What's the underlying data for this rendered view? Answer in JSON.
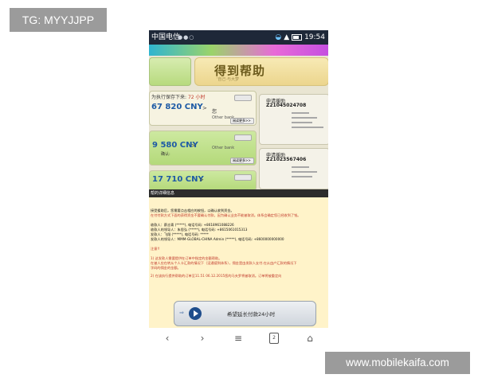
{
  "watermark": {
    "tag": "TG: MYYJJPP",
    "site": "www.mobilekaifa.com"
  },
  "statusbar": {
    "carrier": "中国电信",
    "time": "19:54",
    "icons": [
      "wechat-icon",
      "wechat-icon",
      "search-icon",
      "wifi-icon",
      "signal-icon",
      "battery-icon"
    ]
  },
  "header": {
    "help_label": "得到帮助",
    "help_sub": "'自己·与大梦"
  },
  "left_cards": [
    {
      "label": "为执行保存下来:",
      "deadline": "72 小时",
      "amount": "67 820 CNY",
      "chev": ">",
      "recipient": "您",
      "bank": "Other bank",
      "more": "阅读更多>>"
    },
    {
      "amount": "9 580 CNY",
      "chev": ">",
      "confirm": "确认:",
      "bank": "Other bank",
      "more": "阅读更多>>"
    },
    {
      "amount": "17 710 CNY",
      "chev": ">"
    }
  ],
  "right_cards": [
    {
      "title": "申请援助",
      "id": "Z21045024708"
    },
    {
      "title": "申请援助",
      "id": "Z21023567406"
    }
  ],
  "popup": {
    "title": "帮的详细信息",
    "lines": [
      {
        "text": "接受援助后，您需要点击相应的按钮，以确认收到资金。",
        "style": "title"
      },
      {
        "text": "在付付款方式下面的获得资金不要确认付款，因为确认业务不能被取消。体系会确定您已经收到了钱。",
        "style": "red"
      },
      {
        "text": "收款人：蔡志青 (*****), 电话号码: +8618961088226",
        "style": "title"
      },
      {
        "text": "收款人的领导人：朱思弘 (*****), 电话号码: +8615061015313",
        "style": "title"
      },
      {
        "text": "发款人：飞翔 (*****), 电话号码: *****",
        "style": "title"
      },
      {
        "text": "发款人的领导人：MMM-GLOBAL-CHINA Admin (*****), 电话号码: +8600000000000",
        "style": "title"
      },
      {
        "text": "注意!!",
        "style": "red"
      },
      {
        "text": "1) 这发款人需要提供在订单中指定的金额帮助。",
        "style": "red"
      },
      {
        "text": "在被人应在转从个人卡汇款的情况下（没通德到体系），佣金是由发款人支付.在从由户汇款的情况下",
        "style": "red"
      },
      {
        "text": "字码的佣金的金额。",
        "style": "red"
      },
      {
        "text": "2) 在该执行提供帮助的订单至11.51 06.12.2015您的马夫罗将被取消。订单将被重定向",
        "style": "red"
      }
    ],
    "extend_label": "希望延长付款24小时"
  },
  "navbar": {
    "tab_count": "2"
  }
}
